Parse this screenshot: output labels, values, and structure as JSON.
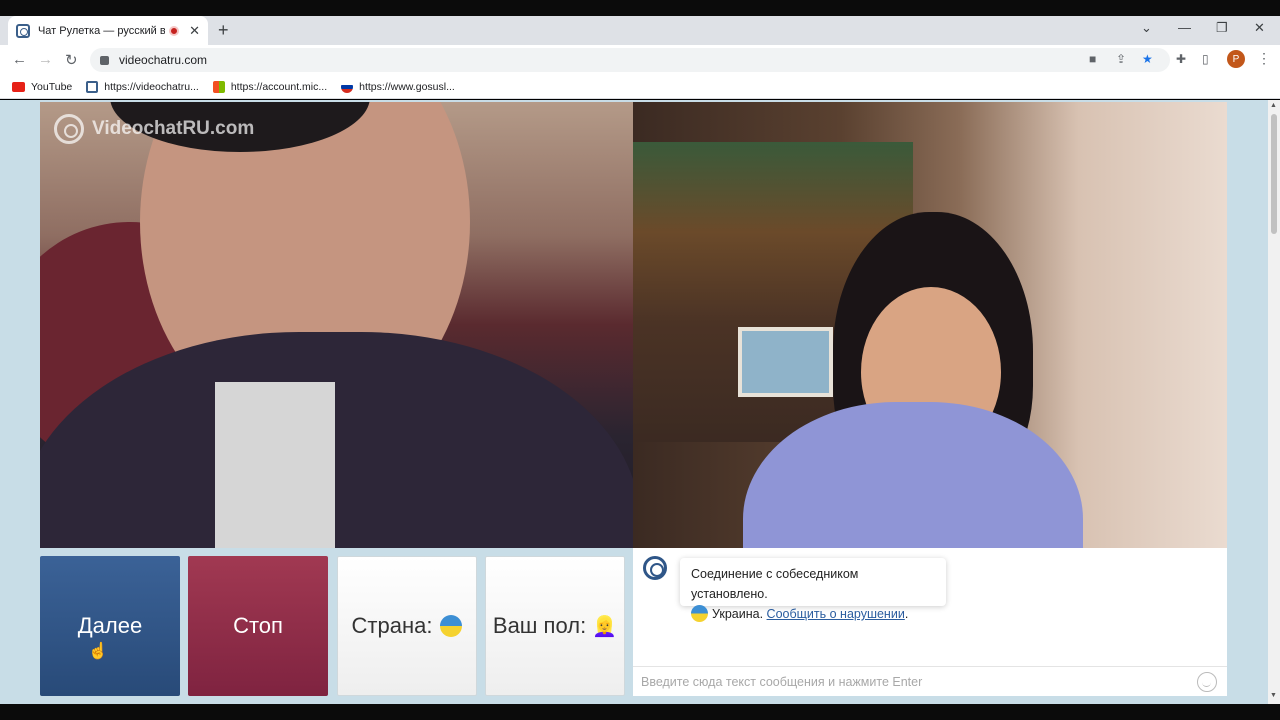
{
  "browser": {
    "tab_title": "Чат Рулетка — русский вид",
    "url": "videochatru.com",
    "profile_initial": "P",
    "icons": [
      "back-arrow-icon",
      "forward-arrow-icon",
      "reload-icon",
      "lock-icon",
      "camera-icon",
      "share-icon",
      "star-icon",
      "extensions-icon",
      "sidepanel-icon",
      "menu-icon"
    ],
    "bookmarks": [
      {
        "label": "YouTube",
        "icon": "youtube-icon",
        "color": "#e62117"
      },
      {
        "label": "https://videochatru...",
        "icon": "videochat-icon",
        "color": "#3b5f8a"
      },
      {
        "label": "https://account.mic...",
        "icon": "microsoft-icon",
        "color": "#f25022"
      },
      {
        "label": "https://www.gosusl...",
        "icon": "gosuslugi-icon",
        "color": "#d52b1e"
      }
    ]
  },
  "watermark": "VideochatRU.com",
  "controls": {
    "next_label": "Далее",
    "stop_label": "Стоп",
    "country_label": "Страна:",
    "gender_label": "Ваш пол:"
  },
  "chat": {
    "message_line1": "Соединение с собеседником установлено.",
    "country_text": "Украина.",
    "report_link": "Сообщить о нарушении",
    "report_suffix": ".",
    "input_placeholder": "Введите сюда текст сообщения и нажмите Enter"
  },
  "colors": {
    "next_button": "#2f5688",
    "stop_button": "#8f2c49",
    "page_bg": "#c8dde7",
    "link": "#2a5c9e"
  }
}
